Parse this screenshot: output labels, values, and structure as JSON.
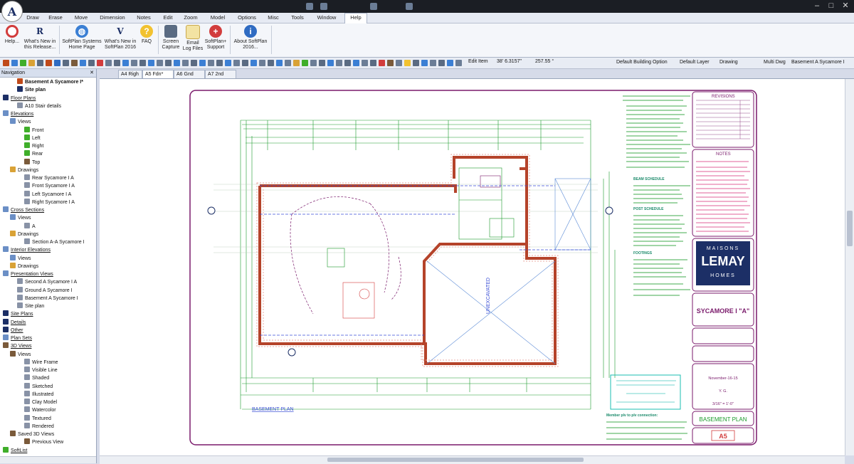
{
  "menu": {
    "items": [
      "Draw",
      "Erase",
      "Move",
      "Dimension",
      "Notes",
      "Edit",
      "Zoom",
      "Model",
      "Options",
      "Misc",
      "Tools",
      "Window",
      "Help"
    ],
    "active": "Help"
  },
  "ribbon": {
    "help": "Help...",
    "whats_new_release": "What's New in this Release...",
    "softplan_home": "SoftPlan Systems Home Page",
    "whats_new_2016": "What's New in SoftPlan 2016",
    "faq": "FAQ",
    "screen_capture": "Screen Capture",
    "email_log": "Email Log Files",
    "softplan_support": "SoftPlan+ Support",
    "about": "About SoftPlan 2016..."
  },
  "toolbar": {
    "edit_item": "Edit Item",
    "coord_x": "38' 6.3157\"",
    "coord_angle": "257.55 °",
    "building_option": "Default Building Option",
    "layer": "Default Layer",
    "mode": "Drawing",
    "multi_dwg": "Multi Dwg",
    "basement": "Basement A Sycamore I"
  },
  "nav": {
    "title": "Navigation",
    "rows": [
      {
        "label": "Basement A Sycamore I*",
        "indent": 2,
        "bold": true,
        "u": false,
        "color": "#c04a1a"
      },
      {
        "label": "Site plan",
        "indent": 2,
        "bold": true,
        "u": false,
        "color": "#1c2f66"
      },
      {
        "label": "Floor Plans",
        "indent": 0,
        "bold": false,
        "u": true,
        "color": "#1c2f66"
      },
      {
        "label": "A10 Stair details",
        "indent": 2,
        "bold": false,
        "u": false,
        "color": "#8892a6"
      },
      {
        "label": "Elevations",
        "indent": 0,
        "bold": false,
        "u": true,
        "color": "#6b8fc6"
      },
      {
        "label": "Views",
        "indent": 1,
        "bold": false,
        "u": false,
        "color": "#6b8fc6"
      },
      {
        "label": "Front",
        "indent": 3,
        "bold": false,
        "u": false,
        "color": "#3fae2a"
      },
      {
        "label": "Left",
        "indent": 3,
        "bold": false,
        "u": false,
        "color": "#3fae2a"
      },
      {
        "label": "Right",
        "indent": 3,
        "bold": false,
        "u": false,
        "color": "#3fae2a"
      },
      {
        "label": "Rear",
        "indent": 3,
        "bold": false,
        "u": false,
        "color": "#3fae2a"
      },
      {
        "label": "Top",
        "indent": 3,
        "bold": false,
        "u": false,
        "color": "#7a5a3a"
      },
      {
        "label": "Drawings",
        "indent": 1,
        "bold": false,
        "u": false,
        "color": "#d9a236"
      },
      {
        "label": "Rear Sycamore I A",
        "indent": 3,
        "bold": false,
        "u": false,
        "color": "#8892a6"
      },
      {
        "label": "Front Sycamore I A",
        "indent": 3,
        "bold": false,
        "u": false,
        "color": "#8892a6"
      },
      {
        "label": "Left Sycamore I A",
        "indent": 3,
        "bold": false,
        "u": false,
        "color": "#8892a6"
      },
      {
        "label": "Right Sycamore I A",
        "indent": 3,
        "bold": false,
        "u": false,
        "color": "#8892a6"
      },
      {
        "label": "Cross Sections",
        "indent": 0,
        "bold": false,
        "u": true,
        "color": "#6b8fc6"
      },
      {
        "label": "Views",
        "indent": 1,
        "bold": false,
        "u": false,
        "color": "#6b8fc6"
      },
      {
        "label": "A",
        "indent": 3,
        "bold": false,
        "u": false,
        "color": "#8892a6"
      },
      {
        "label": "Drawings",
        "indent": 1,
        "bold": false,
        "u": false,
        "color": "#d9a236"
      },
      {
        "label": "Section A-A Sycamore I",
        "indent": 3,
        "bold": false,
        "u": false,
        "color": "#8892a6"
      },
      {
        "label": "Interior Elevations",
        "indent": 0,
        "bold": false,
        "u": true,
        "color": "#6b8fc6"
      },
      {
        "label": "Views",
        "indent": 1,
        "bold": false,
        "u": false,
        "color": "#6b8fc6"
      },
      {
        "label": "Drawings",
        "indent": 1,
        "bold": false,
        "u": false,
        "color": "#d9a236"
      },
      {
        "label": "Presentation Views",
        "indent": 0,
        "bold": false,
        "u": true,
        "color": "#6b8fc6"
      },
      {
        "label": "Second A Sycamore I A",
        "indent": 2,
        "bold": false,
        "u": false,
        "color": "#8892a6"
      },
      {
        "label": "Ground A Sycamore I",
        "indent": 2,
        "bold": false,
        "u": false,
        "color": "#8892a6"
      },
      {
        "label": "Basement A Sycamore I",
        "indent": 2,
        "bold": false,
        "u": false,
        "color": "#8892a6"
      },
      {
        "label": "Site plan",
        "indent": 2,
        "bold": false,
        "u": false,
        "color": "#8892a6"
      },
      {
        "label": "Site Plans",
        "indent": 0,
        "bold": false,
        "u": true,
        "color": "#1c2f66"
      },
      {
        "label": "Details",
        "indent": 0,
        "bold": false,
        "u": true,
        "color": "#1c2f66"
      },
      {
        "label": "Other",
        "indent": 0,
        "bold": false,
        "u": true,
        "color": "#1c2f66"
      },
      {
        "label": "Plan Sets",
        "indent": 0,
        "bold": false,
        "u": true,
        "color": "#6b8fc6"
      },
      {
        "label": "3D Views",
        "indent": 0,
        "bold": false,
        "u": true,
        "color": "#7a5a3a"
      },
      {
        "label": "Views",
        "indent": 1,
        "bold": false,
        "u": false,
        "color": "#7a5a3a"
      },
      {
        "label": "Wire Frame",
        "indent": 3,
        "bold": false,
        "u": false,
        "color": "#8892a6"
      },
      {
        "label": "Visible Line",
        "indent": 3,
        "bold": false,
        "u": false,
        "color": "#8892a6"
      },
      {
        "label": "Shaded",
        "indent": 3,
        "bold": false,
        "u": false,
        "color": "#8892a6"
      },
      {
        "label": "Sketched",
        "indent": 3,
        "bold": false,
        "u": false,
        "color": "#8892a6"
      },
      {
        "label": "Illustrated",
        "indent": 3,
        "bold": false,
        "u": false,
        "color": "#8892a6"
      },
      {
        "label": "Clay Model",
        "indent": 3,
        "bold": false,
        "u": false,
        "color": "#8892a6"
      },
      {
        "label": "Watercolor",
        "indent": 3,
        "bold": false,
        "u": false,
        "color": "#8892a6"
      },
      {
        "label": "Textured",
        "indent": 3,
        "bold": false,
        "u": false,
        "color": "#8892a6"
      },
      {
        "label": "Rendered",
        "indent": 3,
        "bold": false,
        "u": false,
        "color": "#8892a6"
      },
      {
        "label": "Saved 3D Views",
        "indent": 1,
        "bold": false,
        "u": false,
        "color": "#7a5a3a"
      },
      {
        "label": "Previous View",
        "indent": 3,
        "bold": false,
        "u": false,
        "color": "#7a5a3a"
      },
      {
        "label": "SoftList",
        "indent": 0,
        "bold": false,
        "u": true,
        "color": "#3fae2a"
      }
    ]
  },
  "tabs": [
    "A4 Righ",
    "A5 Fdn*",
    "A6 Gnd",
    "A7 2nd"
  ],
  "active_tab": "A5 Fdn*",
  "drawing": {
    "revisions_title": "REVISIONS",
    "notes_title": "NOTES",
    "brand_line1": "MAISONS",
    "brand_line2": "LEMAY",
    "brand_line3": "HOMES",
    "project_name": "SYCAMORE I \"A\"",
    "date": "November-16-15",
    "drawn_by": "Y. G.",
    "scale": "3/16\" = 1'-0\"",
    "sheet_title": "BASEMENT PLAN",
    "sheet_number": "A5",
    "plan_label": "BASEMENT PLAN",
    "unexcavated": "UNEXCAVATED",
    "beam_schedule": "BEAM SCHEDULE",
    "post_schedule": "POST SCHEDULE",
    "footings": "FOOTINGS",
    "member_conn_title": "Member plv to plv connection:"
  }
}
